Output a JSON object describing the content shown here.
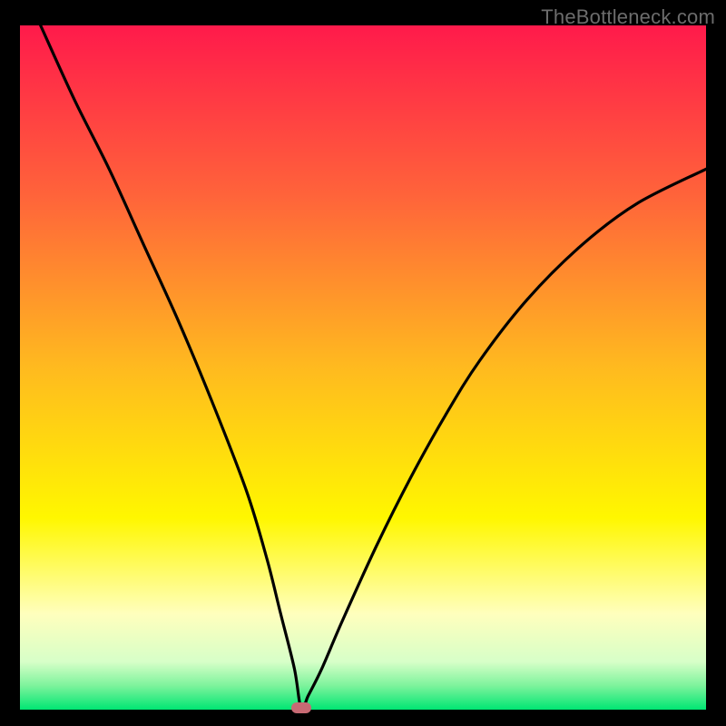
{
  "watermark": "TheBottleneck.com",
  "chart_data": {
    "type": "line",
    "title": "",
    "xlabel": "",
    "ylabel": "",
    "xlim": [
      0,
      100
    ],
    "ylim": [
      0,
      100
    ],
    "note": "V-shaped bottleneck curve over a red-to-green vertical gradient. The curve descends from top-left, reaches its minimum near x≈41 (y≈0), then rises toward the upper-right. Values estimated from pixel positions; no axis ticks or numeric labels are visible.",
    "series": [
      {
        "name": "curve",
        "x": [
          3,
          8,
          13,
          18,
          23,
          28,
          33,
          36,
          38,
          40,
          41,
          42,
          44,
          47,
          52,
          57,
          62,
          67,
          74,
          82,
          90,
          100
        ],
        "y": [
          100,
          89,
          79,
          68,
          57,
          45,
          32,
          22,
          14,
          6,
          0,
          2,
          6,
          13,
          24,
          34,
          43,
          51,
          60,
          68,
          74,
          79
        ]
      }
    ],
    "marker": {
      "x": 41,
      "y": 0,
      "color": "#c76a74"
    },
    "gradient_stops": [
      {
        "offset": 0.0,
        "color": "#ff1a4b"
      },
      {
        "offset": 0.25,
        "color": "#ff643a"
      },
      {
        "offset": 0.5,
        "color": "#ffba1f"
      },
      {
        "offset": 0.72,
        "color": "#fff700"
      },
      {
        "offset": 0.86,
        "color": "#ffffbd"
      },
      {
        "offset": 0.93,
        "color": "#d7ffc8"
      },
      {
        "offset": 0.965,
        "color": "#7df39c"
      },
      {
        "offset": 1.0,
        "color": "#00e673"
      }
    ]
  }
}
